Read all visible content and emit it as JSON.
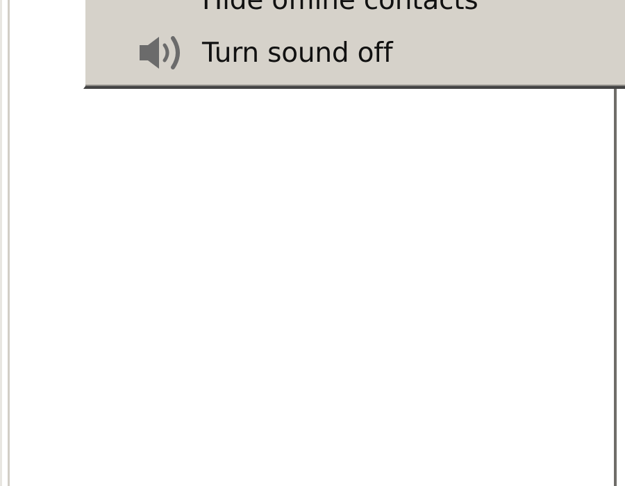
{
  "menu": {
    "items": [
      {
        "label": "Hide offline contacts",
        "icon": "contacts-icon"
      },
      {
        "label": "Turn sound off",
        "icon": "speaker-icon"
      }
    ]
  },
  "colors": {
    "menu_background": "#d6d2ca",
    "menu_shadow": "#444444",
    "icon_gray": "#6b6b6b",
    "text": "#111111"
  }
}
